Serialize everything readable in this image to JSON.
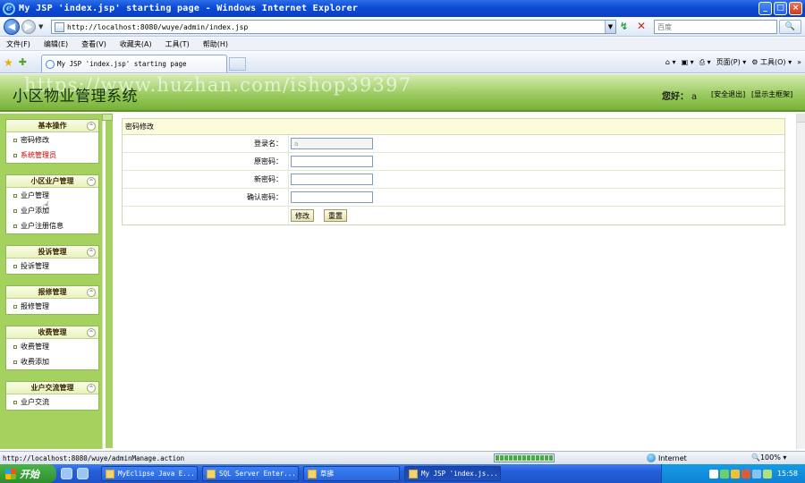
{
  "window": {
    "title": "My JSP 'index.jsp' starting page - Windows Internet Explorer",
    "minimize": "_",
    "maximize": "□",
    "close": "×"
  },
  "browser": {
    "back": "◀",
    "forward": "▶",
    "nav_dropdown": "▼",
    "address": "http://localhost:8080/wuye/admin/index.jsp",
    "address_dropdown": "▼",
    "go": "↯",
    "stop": "✕",
    "search_placeholder": "百度",
    "search_button": "🔍",
    "menus": [
      "文件(F)",
      "编辑(E)",
      "查看(V)",
      "收藏夹(A)",
      "工具(T)",
      "帮助(H)"
    ],
    "tab_title": "My JSP 'index.jsp' starting page",
    "tools": {
      "home": "⌂ ▾",
      "feeds": "▣ ▾",
      "print": "⎙ ▾",
      "page": "页面(P) ▾",
      "tools": "⚙ 工具(O) ▾",
      "more": "»"
    }
  },
  "page": {
    "system_title": "小区物业管理系统",
    "watermark": "https://www.huzhan.com/ishop39397",
    "welcome_label": "您好：",
    "username": "a",
    "logout_link": "[安全退出]",
    "main_frame_link": "[显示主框架]"
  },
  "sidebar": {
    "collapse_icon": "^",
    "groups": [
      {
        "title": "基本操作",
        "items": [
          "密码修改",
          "系统管理员"
        ]
      },
      {
        "title": "小区业户管理",
        "items": [
          "业户管理",
          "业户添加",
          "业户注册信息"
        ]
      },
      {
        "title": "投诉管理",
        "items": [
          "投诉管理"
        ]
      },
      {
        "title": "报修管理",
        "items": [
          "报修管理"
        ]
      },
      {
        "title": "收费管理",
        "items": [
          "收费管理",
          "收费添加"
        ]
      },
      {
        "title": "业户交流管理",
        "items": [
          "业户交流"
        ]
      }
    ]
  },
  "form": {
    "heading": "密码修改",
    "login_label": "登录名：",
    "login_value": "a",
    "old_password_label": "原密码：",
    "new_password_label": "新密码：",
    "confirm_password_label": "确认密码：",
    "submit_button": "修改",
    "reset_button": "重置"
  },
  "statusbar": {
    "url": "http://localhost:8080/wuye/adminManage.action",
    "zone": "Internet",
    "zoom": "🔍100%  ▾"
  },
  "taskbar": {
    "start": "开始",
    "buttons": [
      "MyEclipse Java E...",
      "SQL Server Enter...",
      "草拂",
      "My JSP 'index.js..."
    ],
    "clock": "15:58"
  }
}
